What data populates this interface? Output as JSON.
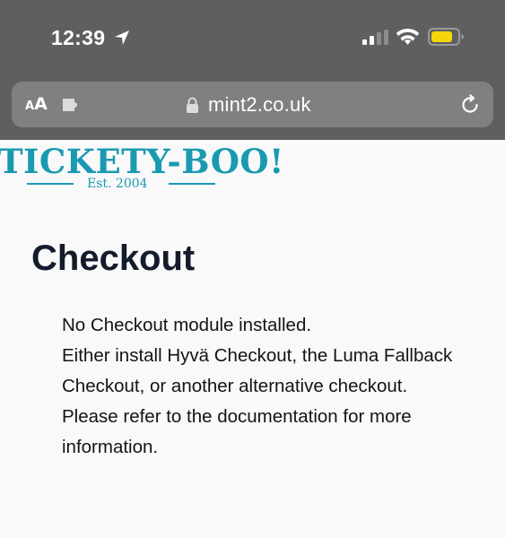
{
  "status_bar": {
    "time": "12:39",
    "icons": [
      "location-arrow-icon",
      "cellular-signal-icon",
      "wifi-icon",
      "battery-icon"
    ],
    "battery_color": "#f5d60a"
  },
  "browser": {
    "text_size_label_small": "A",
    "text_size_label_large": "A",
    "url": "mint2.co.uk"
  },
  "site": {
    "logo_text": "TICKETY-BOO!",
    "logo_tagline": "Est. 2004",
    "brand_color": "#1a9ab0"
  },
  "page": {
    "title": "Checkout",
    "message_lines": [
      "No Checkout module installed.",
      "Either install Hyvä Checkout, the Luma Fallback Checkout, or another alternative checkout.",
      "Please refer to the documentation for more information."
    ]
  }
}
